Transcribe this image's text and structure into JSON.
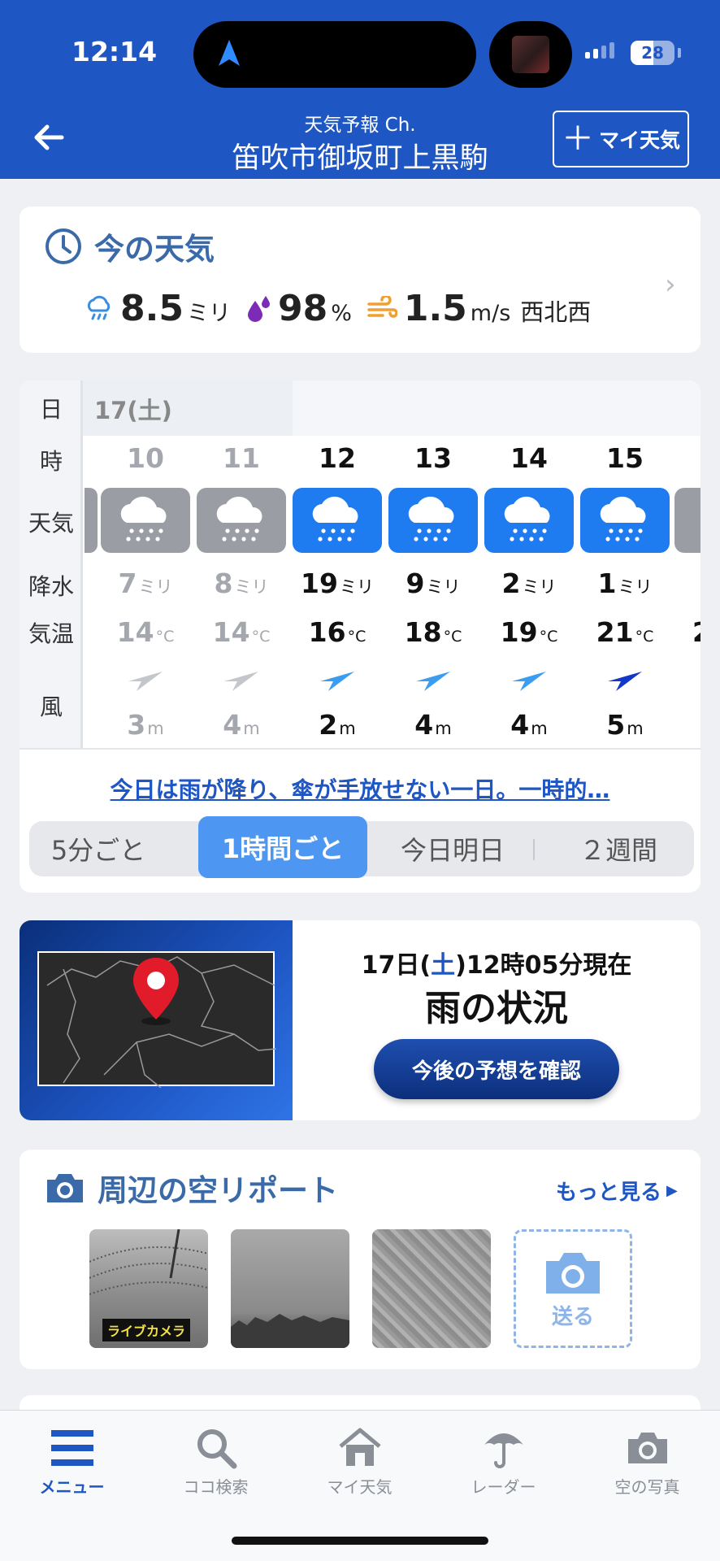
{
  "status_bar": {
    "time": "12:14",
    "battery": "28"
  },
  "header": {
    "subtitle": "天気予報 Ch.",
    "title": "笛吹市御坂町上黒駒",
    "my_weather_label": "マイ天気"
  },
  "now": {
    "title": "今の天気",
    "precip_value": "8.5",
    "precip_unit": "ミリ",
    "humidity_value": "98",
    "humidity_unit": "%",
    "wind_value": "1.5",
    "wind_unit": "m/s",
    "wind_dir": "西北西"
  },
  "forecast": {
    "labels": {
      "day": "日",
      "hour": "時",
      "weather": "天気",
      "precip": "降水",
      "temp": "気温",
      "wind": "風"
    },
    "date": "17(土)",
    "precip_unit": "ミリ",
    "temp_unit": "°C",
    "wind_unit": "m",
    "hours": [
      {
        "hour": "10",
        "precip": "7",
        "temp": "14",
        "wind": "3",
        "past": true
      },
      {
        "hour": "11",
        "precip": "8",
        "temp": "14",
        "wind": "4",
        "past": true
      },
      {
        "hour": "12",
        "precip": "19",
        "temp": "16",
        "wind": "2",
        "past": false
      },
      {
        "hour": "13",
        "precip": "9",
        "temp": "18",
        "wind": "4",
        "past": false
      },
      {
        "hour": "14",
        "precip": "2",
        "temp": "19",
        "wind": "4",
        "past": false
      },
      {
        "hour": "15",
        "precip": "1",
        "temp": "21",
        "wind": "5",
        "past": false
      }
    ],
    "summary": "今日は雨が降り、傘が手放せない一日。一時的…",
    "tabs": [
      "5分ごと",
      "1時間ごと",
      "今日明日",
      "２週間"
    ],
    "active_tab": "1時間ごと"
  },
  "rain": {
    "when_prefix": "17日(",
    "when_day": "土",
    "when_suffix": ")12時05分現在",
    "headline": "雨の状況",
    "button": "今後の予想を確認"
  },
  "sky": {
    "title": "周辺の空リポート",
    "more": "もっと見る",
    "live_tag": "ライブカメラ",
    "send": "送る"
  },
  "tabbar": {
    "items": [
      "メニュー",
      "ココ検索",
      "マイ天気",
      "レーダー",
      "空の写真"
    ],
    "active": "メニュー"
  },
  "colors": {
    "brand_blue": "#1e56c4",
    "tile_active": "#1f7bf0",
    "tile_past": "#9a9da3",
    "title_blue": "#3b6aa8"
  }
}
